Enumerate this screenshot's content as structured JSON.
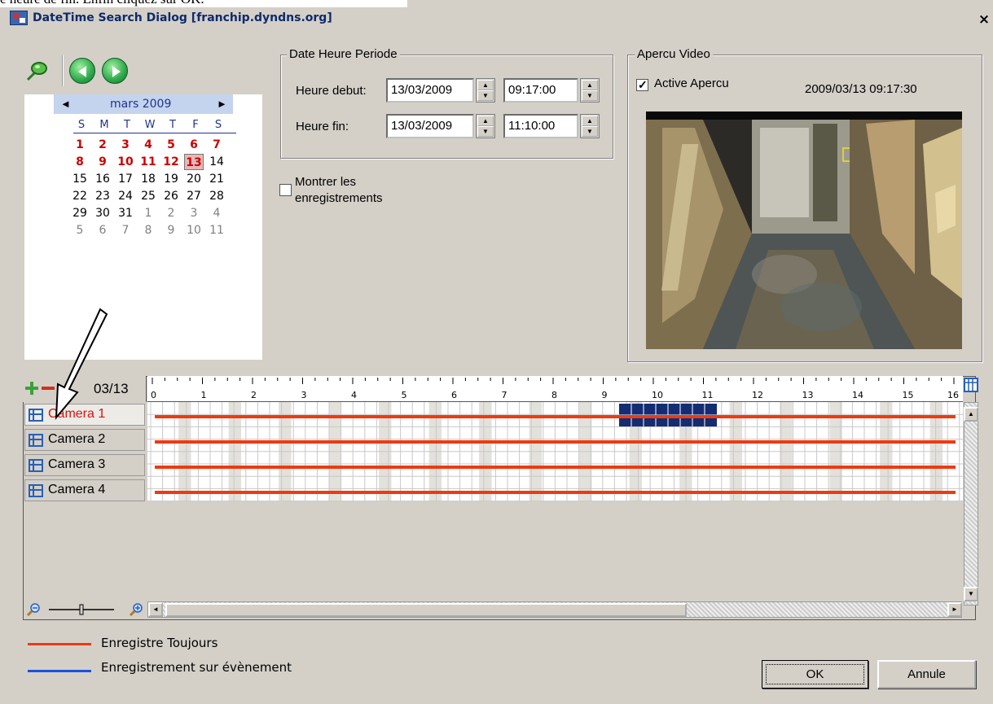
{
  "caption_above": "e heure de fin. Enfin cliquez sur OK.",
  "window": {
    "title": "DateTime Search Dialog  [franchip.dyndns.org]",
    "close": "×"
  },
  "calendar": {
    "month": "mars 2009",
    "prev": "◄",
    "next": "►",
    "dow": [
      "S",
      "M",
      "T",
      "W",
      "T",
      "F",
      "S"
    ],
    "weeks": [
      [
        [
          "1",
          "bold"
        ],
        [
          "2",
          "bold"
        ],
        [
          "3",
          "bold"
        ],
        [
          "4",
          "bold"
        ],
        [
          "5",
          "bold"
        ],
        [
          "6",
          "bold"
        ],
        [
          "7",
          "bold"
        ]
      ],
      [
        [
          "8",
          "bold"
        ],
        [
          "9",
          "bold"
        ],
        [
          "10",
          "bold"
        ],
        [
          "11",
          "bold"
        ],
        [
          "12",
          "bold"
        ],
        [
          "13",
          "today"
        ],
        [
          "14",
          "norm"
        ]
      ],
      [
        [
          "15",
          "norm"
        ],
        [
          "16",
          "norm"
        ],
        [
          "17",
          "norm"
        ],
        [
          "18",
          "norm"
        ],
        [
          "19",
          "norm"
        ],
        [
          "20",
          "norm"
        ],
        [
          "21",
          "norm"
        ]
      ],
      [
        [
          "22",
          "norm"
        ],
        [
          "23",
          "norm"
        ],
        [
          "24",
          "norm"
        ],
        [
          "25",
          "norm"
        ],
        [
          "26",
          "norm"
        ],
        [
          "27",
          "norm"
        ],
        [
          "28",
          "norm"
        ]
      ],
      [
        [
          "29",
          "norm"
        ],
        [
          "30",
          "norm"
        ],
        [
          "31",
          "norm"
        ],
        [
          "1",
          "grey"
        ],
        [
          "2",
          "grey"
        ],
        [
          "3",
          "grey"
        ],
        [
          "4",
          "grey"
        ]
      ],
      [
        [
          "5",
          "grey"
        ],
        [
          "6",
          "grey"
        ],
        [
          "7",
          "grey"
        ],
        [
          "8",
          "grey"
        ],
        [
          "9",
          "grey"
        ],
        [
          "10",
          "grey"
        ],
        [
          "11",
          "grey"
        ]
      ]
    ]
  },
  "period": {
    "legend": "Date Heure Periode",
    "start_label": "Heure debut:",
    "start_date": "13/03/2009",
    "start_time": "09:17:00",
    "end_label": "Heure fin:",
    "end_date": "13/03/2009",
    "end_time": "11:10:00"
  },
  "show_recordings": {
    "label_1": "Montrer les",
    "label_2": "enregistrements",
    "checked": false
  },
  "preview": {
    "legend": "Apercu Video",
    "active_label": "Active Apercu",
    "active_checked": true,
    "timestamp": "2009/03/13 09:17:30",
    "check_mark": "✓"
  },
  "timeline": {
    "date": "03/13",
    "hours": [
      "0",
      "1",
      "2",
      "3",
      "4",
      "5",
      "6",
      "7",
      "8",
      "9",
      "10",
      "11",
      "12",
      "13",
      "14",
      "15",
      "16"
    ],
    "selection": {
      "start": 9.3,
      "end": 11.2
    },
    "cameras": [
      "Camera 1",
      "Camera 2",
      "Camera 3",
      "Camera 4"
    ],
    "selected_camera": "Camera 1",
    "colors": {
      "always": "#ee3a10",
      "event": "#1a4fe0",
      "selection": "#142c72"
    }
  },
  "legend": {
    "always": "Enregistre Toujours",
    "event": "Enregistrement sur évènement"
  },
  "buttons": {
    "ok": "OK",
    "cancel": "Annule"
  },
  "icons": [
    "pin-icon",
    "prev-arrow-icon",
    "next-arrow-icon",
    "add-icon",
    "remove-icon",
    "zoom-out-icon",
    "zoom-in-icon",
    "calendar-grid-icon"
  ]
}
